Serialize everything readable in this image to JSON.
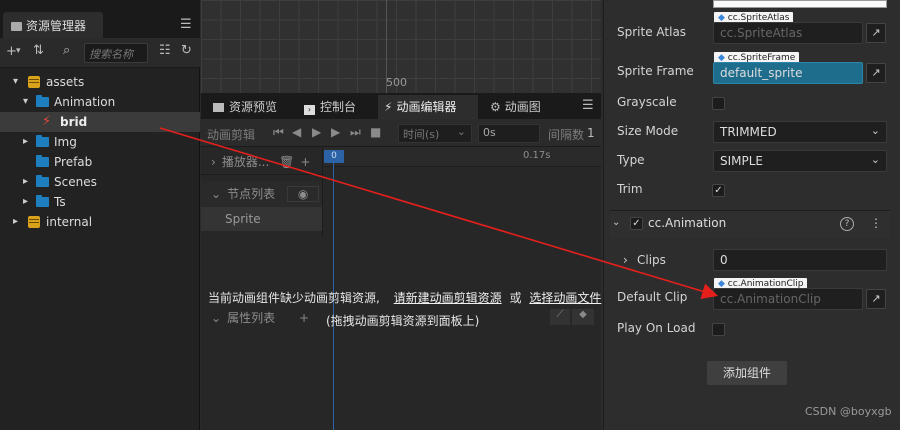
{
  "assets_panel": {
    "tab_label": "资源管理器",
    "search_placeholder": "搜索名称",
    "tree": [
      {
        "label": "assets",
        "icon": "database-icon"
      },
      {
        "label": "Animation",
        "icon": "folder-icon"
      },
      {
        "label": "brid",
        "icon": "animation-clip-icon"
      },
      {
        "label": "Img",
        "icon": "folder-icon"
      },
      {
        "label": "Prefab",
        "icon": "folder-icon"
      },
      {
        "label": "Scenes",
        "icon": "folder-icon"
      },
      {
        "label": "Ts",
        "icon": "folder-icon"
      },
      {
        "label": "internal",
        "icon": "database-icon"
      }
    ]
  },
  "scene": {
    "axis_label": "500"
  },
  "mid_tabs": [
    {
      "label": "资源预览"
    },
    {
      "label": "控制台"
    },
    {
      "label": "动画编辑器"
    },
    {
      "label": "动画图"
    }
  ],
  "animation_editor": {
    "clip_label": "动画剪辑",
    "time_unit": "时间(s)",
    "time_value": "0s",
    "interval_label": "间隔数",
    "interval_value": "1",
    "player_label": "播放器...",
    "node_list_label": "节点列表",
    "node_name": "Sprite",
    "property_list_label": "属性列表",
    "playhead_frame": "0",
    "tick_label": "0.17s",
    "missing_message_prefix": "当前动画组件缺少动画剪辑资源,",
    "create_link": "请新建动画剪辑资源",
    "or_text": "或",
    "select_link": "选择动画文件",
    "drag_hint": "(拖拽动画剪辑资源到面板上)"
  },
  "inspector": {
    "sprite_atlas": {
      "label": "Sprite Atlas",
      "tag": "cc.SpriteAtlas",
      "placeholder": "cc.SpriteAtlas"
    },
    "sprite_frame": {
      "label": "Sprite Frame",
      "tag": "cc.SpriteFrame",
      "value": "default_sprite"
    },
    "grayscale": {
      "label": "Grayscale",
      "checked": false
    },
    "size_mode": {
      "label": "Size Mode",
      "value": "TRIMMED"
    },
    "type": {
      "label": "Type",
      "value": "SIMPLE"
    },
    "trim": {
      "label": "Trim",
      "checked": true
    },
    "component_title": "cc.Animation",
    "clips": {
      "label": "Clips",
      "value": "0"
    },
    "default_clip": {
      "label": "Default Clip",
      "tag": "cc.AnimationClip",
      "placeholder": "cc.AnimationClip"
    },
    "play_on_load": {
      "label": "Play On Load",
      "checked": false
    },
    "add_component": "添加组件"
  },
  "watermark": "CSDN @boyxgb",
  "colors": {
    "accent_blue": "#2c63a7",
    "selected_field": "#1e6d8c",
    "annotation_arrow": "#e5201c"
  }
}
